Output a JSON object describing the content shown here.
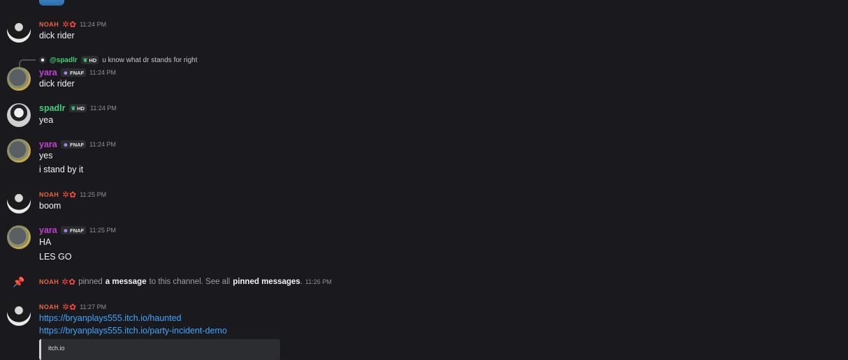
{
  "messages": [
    {
      "id": "m1",
      "author": "NOAH",
      "time": "11:24 PM",
      "lines": [
        "dick rider"
      ]
    },
    {
      "id": "m2",
      "author": "yara",
      "tag": "FNAF",
      "time": "11:24 PM",
      "reply": {
        "author": "@spadlr",
        "tag": "HD",
        "text": "u know what dr stands for right"
      },
      "lines": [
        "dick rider"
      ]
    },
    {
      "id": "m3",
      "author": "spadlr",
      "tag": "HD",
      "time": "11:24 PM",
      "lines": [
        "yea"
      ]
    },
    {
      "id": "m4",
      "author": "yara",
      "tag": "FNAF",
      "time": "11:24 PM",
      "lines": [
        "yes",
        "i stand by it"
      ]
    },
    {
      "id": "m5",
      "author": "NOAH",
      "time": "11:25 PM",
      "lines": [
        "boom"
      ]
    },
    {
      "id": "m6",
      "author": "yara",
      "tag": "FNAF",
      "time": "11:25 PM",
      "lines": [
        "HA",
        "LES GO"
      ]
    },
    {
      "id": "m8",
      "author": "NOAH",
      "time": "11:27 PM",
      "lines": [
        "https://bryanplays555.itch.io/haunted",
        "https://bryanplays555.itch.io/party-incident-demo"
      ]
    }
  ],
  "system": {
    "author": "NOAH",
    "t1": "pinned",
    "t2": "a message",
    "t3": "to this channel. See all",
    "t4": "pinned messages",
    "t5": ".",
    "time": "11:26 PM"
  },
  "embed": {
    "site": "itch.io"
  },
  "colors": {
    "noah": "#f0643c",
    "yara": "#c63fd6",
    "spadlr": "#3fd07a",
    "link": "#3ea6ff",
    "background": "#1a1a1e"
  },
  "icons": {
    "pin": "pin-icon",
    "noah_deco": "star-burst-icon",
    "fnaf_tag": "skull-icon",
    "hd_tag": "leaf-icon"
  }
}
